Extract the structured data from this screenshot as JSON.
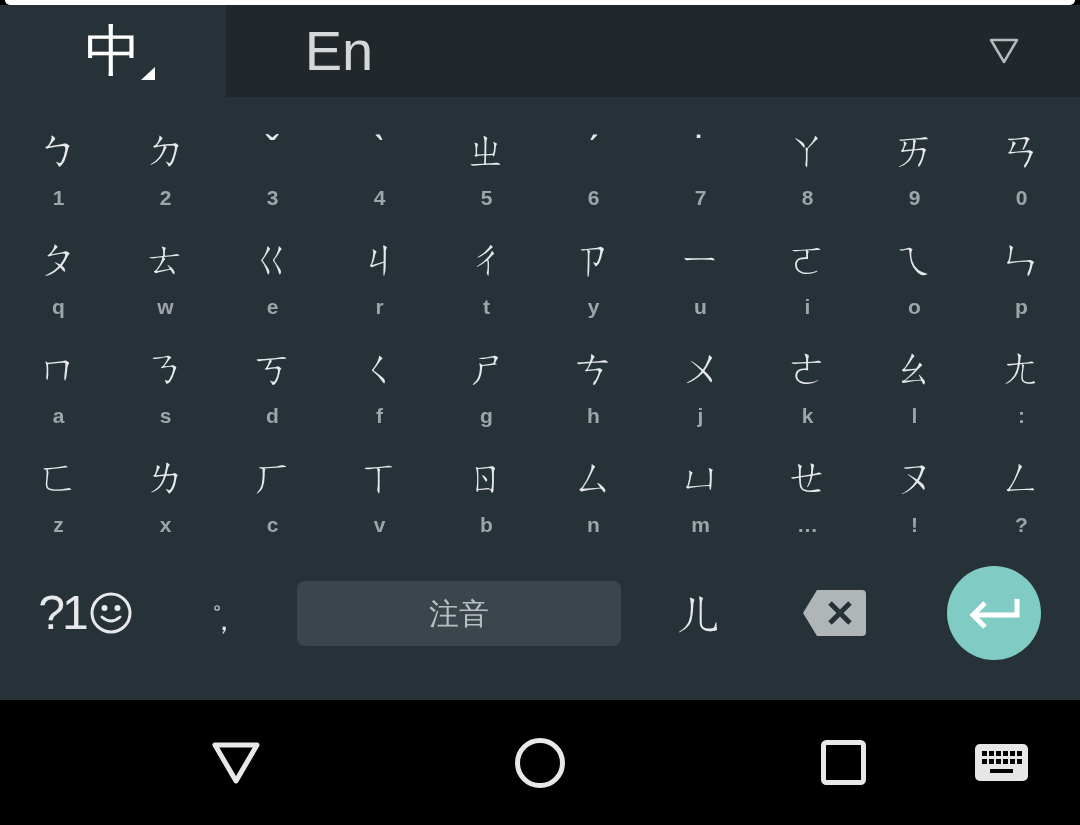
{
  "language_tabs": [
    {
      "label": "中",
      "selected": true
    },
    {
      "label": "En",
      "selected": false
    }
  ],
  "key_rows": [
    [
      {
        "char": "ㄅ",
        "hint": "1"
      },
      {
        "char": "ㄉ",
        "hint": "2"
      },
      {
        "char": "ˇ",
        "hint": "3"
      },
      {
        "char": "ˋ",
        "hint": "4"
      },
      {
        "char": "ㄓ",
        "hint": "5"
      },
      {
        "char": "ˊ",
        "hint": "6"
      },
      {
        "char": "˙",
        "hint": "7"
      },
      {
        "char": "ㄚ",
        "hint": "8"
      },
      {
        "char": "ㄞ",
        "hint": "9"
      },
      {
        "char": "ㄢ",
        "hint": "0"
      }
    ],
    [
      {
        "char": "ㄆ",
        "hint": "q"
      },
      {
        "char": "ㄊ",
        "hint": "w"
      },
      {
        "char": "ㄍ",
        "hint": "e"
      },
      {
        "char": "ㄐ",
        "hint": "r"
      },
      {
        "char": "ㄔ",
        "hint": "t"
      },
      {
        "char": "ㄗ",
        "hint": "y"
      },
      {
        "char": "ㄧ",
        "hint": "u"
      },
      {
        "char": "ㄛ",
        "hint": "i"
      },
      {
        "char": "ㄟ",
        "hint": "o"
      },
      {
        "char": "ㄣ",
        "hint": "p"
      }
    ],
    [
      {
        "char": "ㄇ",
        "hint": "a"
      },
      {
        "char": "ㄋ",
        "hint": "s"
      },
      {
        "char": "ㄎ",
        "hint": "d"
      },
      {
        "char": "ㄑ",
        "hint": "f"
      },
      {
        "char": "ㄕ",
        "hint": "g"
      },
      {
        "char": "ㄘ",
        "hint": "h"
      },
      {
        "char": "ㄨ",
        "hint": "j"
      },
      {
        "char": "ㄜ",
        "hint": "k"
      },
      {
        "char": "ㄠ",
        "hint": "l"
      },
      {
        "char": "ㄤ",
        "hint": ":"
      }
    ],
    [
      {
        "char": "ㄈ",
        "hint": "z"
      },
      {
        "char": "ㄌ",
        "hint": "x"
      },
      {
        "char": "ㄏ",
        "hint": "c"
      },
      {
        "char": "ㄒ",
        "hint": "v"
      },
      {
        "char": "ㄖ",
        "hint": "b"
      },
      {
        "char": "ㄙ",
        "hint": "n"
      },
      {
        "char": "ㄩ",
        "hint": "m"
      },
      {
        "char": "ㄝ",
        "hint": "…"
      },
      {
        "char": "ㄡ",
        "hint": "!"
      },
      {
        "char": "ㄥ",
        "hint": "?"
      }
    ]
  ],
  "bottom_row": {
    "symbols_key": "?1",
    "punctuation_key": {
      "top": "。",
      "bottom": "，"
    },
    "space_key": "注音",
    "extra_key": "ㄦ"
  }
}
